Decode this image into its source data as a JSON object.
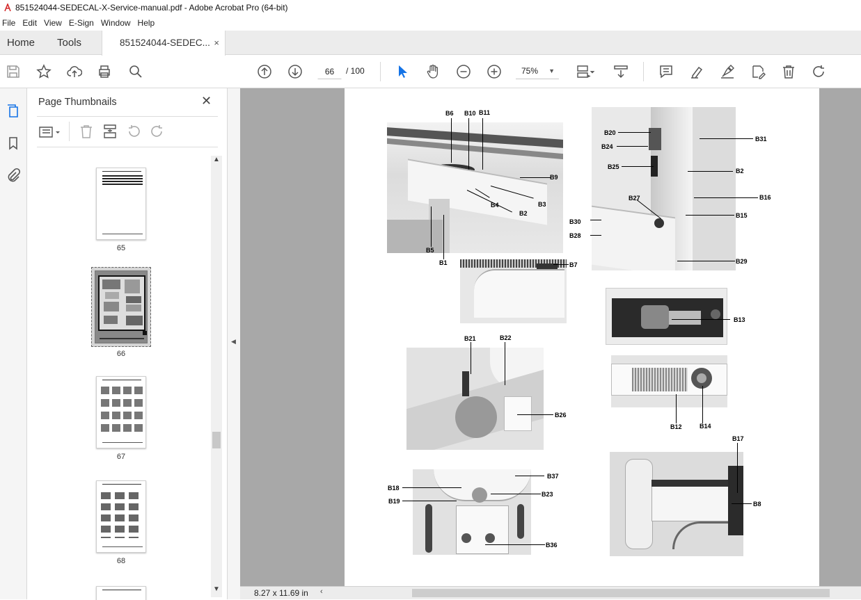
{
  "window": {
    "title": "851524044-SEDECAL-X-Service-manual.pdf - Adobe Acrobat Pro (64-bit)"
  },
  "menu": [
    "File",
    "Edit",
    "View",
    "E-Sign",
    "Window",
    "Help"
  ],
  "tabs": {
    "home": "Home",
    "tools": "Tools",
    "document": "851524044-SEDEC...",
    "close": "×"
  },
  "navigation": {
    "current_page": "66",
    "total_pages": "/ 100",
    "zoom": "75%"
  },
  "panel": {
    "title": "Page Thumbnails",
    "thumbnails": [
      {
        "label": "65"
      },
      {
        "label": "66",
        "selected": true
      },
      {
        "label": "67"
      },
      {
        "label": "68"
      }
    ]
  },
  "status": {
    "page_size": "8.27 x 11.69 in"
  },
  "callouts": {
    "b6": "B6",
    "b10": "B10",
    "b11": "B11",
    "b9": "B9",
    "b3": "B3",
    "b4": "B4",
    "b2a": "B2",
    "b5": "B5",
    "b1": "B1",
    "b7": "B7",
    "b20": "B20",
    "b24": "B24",
    "b25": "B25",
    "b31": "B31",
    "b2b": "B2",
    "b16": "B16",
    "b27": "B27",
    "b15": "B15",
    "b30": "B30",
    "b28": "B28",
    "b29": "B29",
    "b13": "B13",
    "b12": "B12",
    "b14": "B14",
    "b21": "B21",
    "b22": "B22",
    "b26": "B26",
    "b37": "B37",
    "b18": "B18",
    "b23": "B23",
    "b19": "B19",
    "b36": "B36",
    "b17": "B17",
    "b8": "B8"
  },
  "colors": {
    "accent": "#1473e6",
    "viewer_bg": "#a8a8a8",
    "toolbar_bg": "#ffffff"
  }
}
